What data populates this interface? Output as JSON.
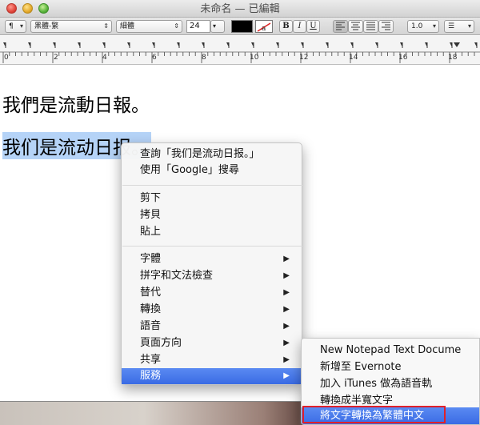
{
  "window": {
    "title": "未命名 — 已編輯"
  },
  "toolbar": {
    "paragraph_label": "¶",
    "font_family": "黑體-繁",
    "font_style": "細體",
    "font_size": "24",
    "text_color": "#000000",
    "bold_label": "B",
    "italic_label": "I",
    "underline_label": "U",
    "line_spacing": "1.0",
    "list_label": "☰"
  },
  "ruler": {
    "numbers": [
      "0",
      "2",
      "4",
      "6",
      "8",
      "10",
      "12",
      "14",
      "16",
      "18"
    ]
  },
  "document": {
    "line1": "我們是流動日報。",
    "line2": "我们是流动日报。",
    "selection_color": "#b5d3f7"
  },
  "context_menu": {
    "lookup": "查詢「我们是流动日报。」",
    "search_google": "使用「Google」搜尋",
    "cut": "剪下",
    "copy": "拷貝",
    "paste": "貼上",
    "font": "字體",
    "spelling": "拼字和文法檢查",
    "substitutions": "替代",
    "transformations": "轉換",
    "speech": "語音",
    "layout_orientation": "頁面方向",
    "share": "共享",
    "services": "服務",
    "submenu_arrow": "▶"
  },
  "services_menu": {
    "items": [
      "New Notepad Text Docume",
      "新增至 Evernote",
      "加入 iTunes 做為語音軌",
      "轉換成半寬文字",
      "將文字轉換為繁體中文"
    ]
  },
  "colors": {
    "highlight": "#3a6be4",
    "annotation_box": "#e0202a"
  }
}
